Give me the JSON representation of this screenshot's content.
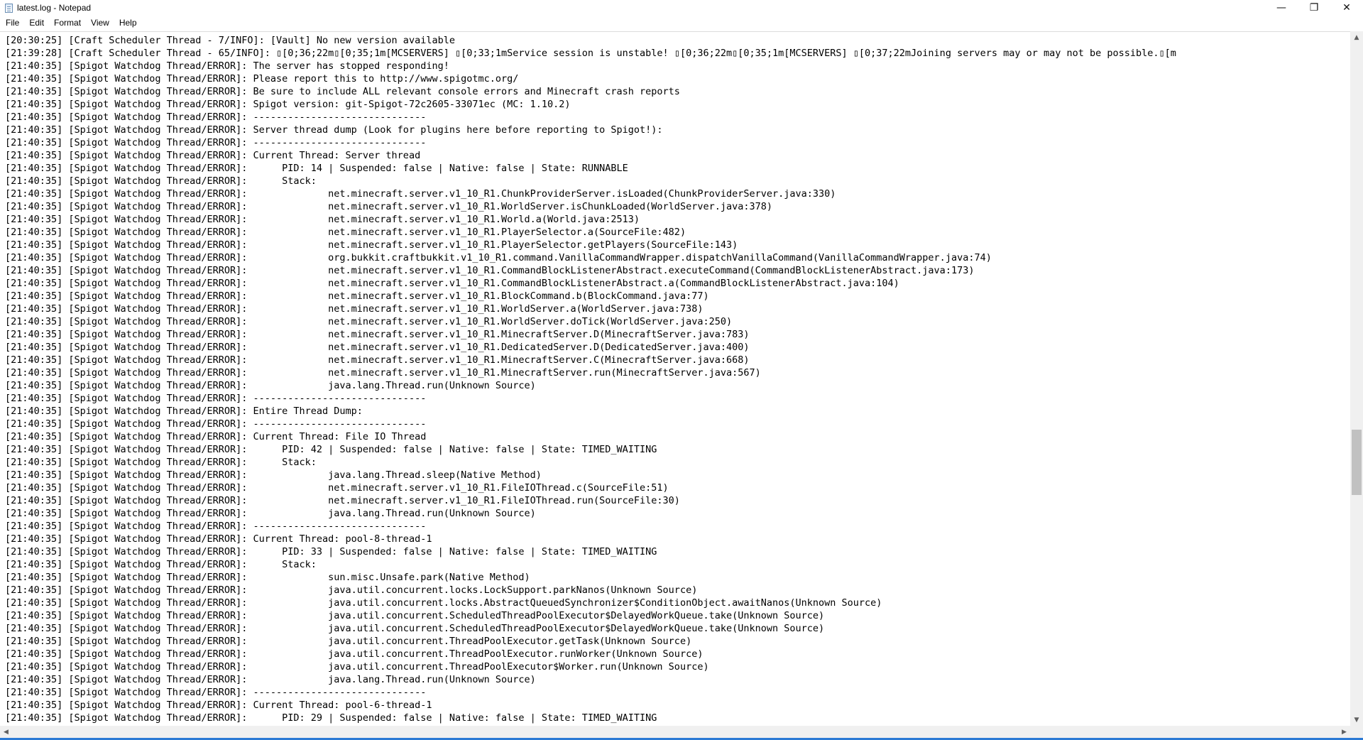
{
  "window": {
    "title": "latest.log - Notepad",
    "controls": {
      "minimize": "—",
      "maximize": "❐",
      "close": "✕"
    }
  },
  "menu": [
    "File",
    "Edit",
    "Format",
    "View",
    "Help"
  ],
  "scrollbar": {
    "up": "▲",
    "down": "▼",
    "left": "◀",
    "right": "▶"
  },
  "lines": [
    "[20:30:25] [Craft Scheduler Thread - 7/INFO]: [Vault] No new version available",
    "[21:39:28] [Craft Scheduler Thread - 65/INFO]: ▯[0;36;22m▯[0;35;1m[MCSERVERS] ▯[0;33;1mService session is unstable! ▯[0;36;22m▯[0;35;1m[MCSERVERS] ▯[0;37;22mJoining servers may or may not be possible.▯[m",
    "[21:40:35] [Spigot Watchdog Thread/ERROR]: The server has stopped responding!",
    "[21:40:35] [Spigot Watchdog Thread/ERROR]: Please report this to http://www.spigotmc.org/",
    "[21:40:35] [Spigot Watchdog Thread/ERROR]: Be sure to include ALL relevant console errors and Minecraft crash reports",
    "[21:40:35] [Spigot Watchdog Thread/ERROR]: Spigot version: git-Spigot-72c2605-33071ec (MC: 1.10.2)",
    "[21:40:35] [Spigot Watchdog Thread/ERROR]: ------------------------------",
    "[21:40:35] [Spigot Watchdog Thread/ERROR]: Server thread dump (Look for plugins here before reporting to Spigot!):",
    "[21:40:35] [Spigot Watchdog Thread/ERROR]: ------------------------------",
    "[21:40:35] [Spigot Watchdog Thread/ERROR]: Current Thread: Server thread",
    "[21:40:35] [Spigot Watchdog Thread/ERROR]: \tPID: 14 | Suspended: false | Native: false | State: RUNNABLE",
    "[21:40:35] [Spigot Watchdog Thread/ERROR]: \tStack:",
    "[21:40:35] [Spigot Watchdog Thread/ERROR]: \t\tnet.minecraft.server.v1_10_R1.ChunkProviderServer.isLoaded(ChunkProviderServer.java:330)",
    "[21:40:35] [Spigot Watchdog Thread/ERROR]: \t\tnet.minecraft.server.v1_10_R1.WorldServer.isChunkLoaded(WorldServer.java:378)",
    "[21:40:35] [Spigot Watchdog Thread/ERROR]: \t\tnet.minecraft.server.v1_10_R1.World.a(World.java:2513)",
    "[21:40:35] [Spigot Watchdog Thread/ERROR]: \t\tnet.minecraft.server.v1_10_R1.PlayerSelector.a(SourceFile:482)",
    "[21:40:35] [Spigot Watchdog Thread/ERROR]: \t\tnet.minecraft.server.v1_10_R1.PlayerSelector.getPlayers(SourceFile:143)",
    "[21:40:35] [Spigot Watchdog Thread/ERROR]: \t\torg.bukkit.craftbukkit.v1_10_R1.command.VanillaCommandWrapper.dispatchVanillaCommand(VanillaCommandWrapper.java:74)",
    "[21:40:35] [Spigot Watchdog Thread/ERROR]: \t\tnet.minecraft.server.v1_10_R1.CommandBlockListenerAbstract.executeCommand(CommandBlockListenerAbstract.java:173)",
    "[21:40:35] [Spigot Watchdog Thread/ERROR]: \t\tnet.minecraft.server.v1_10_R1.CommandBlockListenerAbstract.a(CommandBlockListenerAbstract.java:104)",
    "[21:40:35] [Spigot Watchdog Thread/ERROR]: \t\tnet.minecraft.server.v1_10_R1.BlockCommand.b(BlockCommand.java:77)",
    "[21:40:35] [Spigot Watchdog Thread/ERROR]: \t\tnet.minecraft.server.v1_10_R1.WorldServer.a(WorldServer.java:738)",
    "[21:40:35] [Spigot Watchdog Thread/ERROR]: \t\tnet.minecraft.server.v1_10_R1.WorldServer.doTick(WorldServer.java:250)",
    "[21:40:35] [Spigot Watchdog Thread/ERROR]: \t\tnet.minecraft.server.v1_10_R1.MinecraftServer.D(MinecraftServer.java:783)",
    "[21:40:35] [Spigot Watchdog Thread/ERROR]: \t\tnet.minecraft.server.v1_10_R1.DedicatedServer.D(DedicatedServer.java:400)",
    "[21:40:35] [Spigot Watchdog Thread/ERROR]: \t\tnet.minecraft.server.v1_10_R1.MinecraftServer.C(MinecraftServer.java:668)",
    "[21:40:35] [Spigot Watchdog Thread/ERROR]: \t\tnet.minecraft.server.v1_10_R1.MinecraftServer.run(MinecraftServer.java:567)",
    "[21:40:35] [Spigot Watchdog Thread/ERROR]: \t\tjava.lang.Thread.run(Unknown Source)",
    "[21:40:35] [Spigot Watchdog Thread/ERROR]: ------------------------------",
    "[21:40:35] [Spigot Watchdog Thread/ERROR]: Entire Thread Dump:",
    "[21:40:35] [Spigot Watchdog Thread/ERROR]: ------------------------------",
    "[21:40:35] [Spigot Watchdog Thread/ERROR]: Current Thread: File IO Thread",
    "[21:40:35] [Spigot Watchdog Thread/ERROR]: \tPID: 42 | Suspended: false | Native: false | State: TIMED_WAITING",
    "[21:40:35] [Spigot Watchdog Thread/ERROR]: \tStack:",
    "[21:40:35] [Spigot Watchdog Thread/ERROR]: \t\tjava.lang.Thread.sleep(Native Method)",
    "[21:40:35] [Spigot Watchdog Thread/ERROR]: \t\tnet.minecraft.server.v1_10_R1.FileIOThread.c(SourceFile:51)",
    "[21:40:35] [Spigot Watchdog Thread/ERROR]: \t\tnet.minecraft.server.v1_10_R1.FileIOThread.run(SourceFile:30)",
    "[21:40:35] [Spigot Watchdog Thread/ERROR]: \t\tjava.lang.Thread.run(Unknown Source)",
    "[21:40:35] [Spigot Watchdog Thread/ERROR]: ------------------------------",
    "[21:40:35] [Spigot Watchdog Thread/ERROR]: Current Thread: pool-8-thread-1",
    "[21:40:35] [Spigot Watchdog Thread/ERROR]: \tPID: 33 | Suspended: false | Native: false | State: TIMED_WAITING",
    "[21:40:35] [Spigot Watchdog Thread/ERROR]: \tStack:",
    "[21:40:35] [Spigot Watchdog Thread/ERROR]: \t\tsun.misc.Unsafe.park(Native Method)",
    "[21:40:35] [Spigot Watchdog Thread/ERROR]: \t\tjava.util.concurrent.locks.LockSupport.parkNanos(Unknown Source)",
    "[21:40:35] [Spigot Watchdog Thread/ERROR]: \t\tjava.util.concurrent.locks.AbstractQueuedSynchronizer$ConditionObject.awaitNanos(Unknown Source)",
    "[21:40:35] [Spigot Watchdog Thread/ERROR]: \t\tjava.util.concurrent.ScheduledThreadPoolExecutor$DelayedWorkQueue.take(Unknown Source)",
    "[21:40:35] [Spigot Watchdog Thread/ERROR]: \t\tjava.util.concurrent.ScheduledThreadPoolExecutor$DelayedWorkQueue.take(Unknown Source)",
    "[21:40:35] [Spigot Watchdog Thread/ERROR]: \t\tjava.util.concurrent.ThreadPoolExecutor.getTask(Unknown Source)",
    "[21:40:35] [Spigot Watchdog Thread/ERROR]: \t\tjava.util.concurrent.ThreadPoolExecutor.runWorker(Unknown Source)",
    "[21:40:35] [Spigot Watchdog Thread/ERROR]: \t\tjava.util.concurrent.ThreadPoolExecutor$Worker.run(Unknown Source)",
    "[21:40:35] [Spigot Watchdog Thread/ERROR]: \t\tjava.lang.Thread.run(Unknown Source)",
    "[21:40:35] [Spigot Watchdog Thread/ERROR]: ------------------------------",
    "[21:40:35] [Spigot Watchdog Thread/ERROR]: Current Thread: pool-6-thread-1",
    "[21:40:35] [Spigot Watchdog Thread/ERROR]: \tPID: 29 | Suspended: false | Native: false | State: TIMED_WAITING"
  ]
}
